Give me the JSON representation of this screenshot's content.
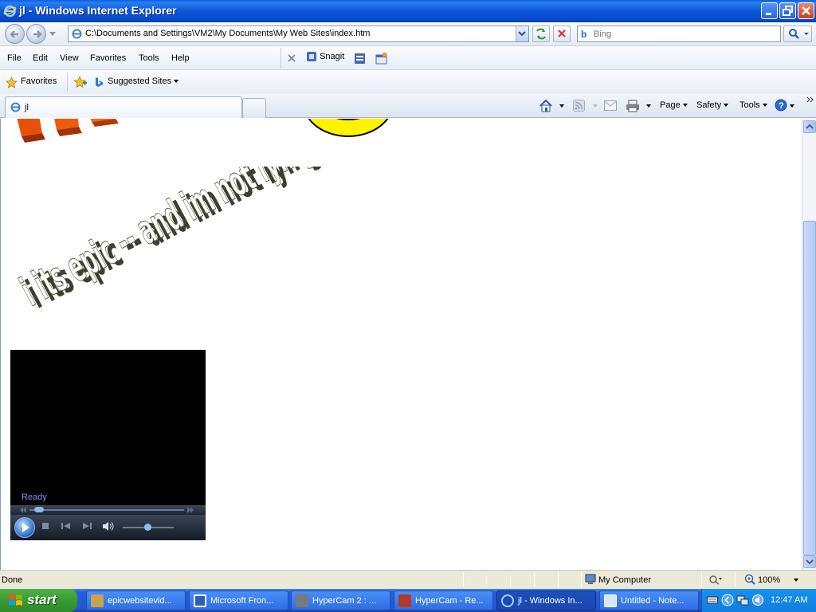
{
  "window": {
    "title": "jl - Windows Internet Explorer"
  },
  "address": {
    "url": "C:\\Documents and Settings\\VM2\\My Documents\\My Web Sites\\index.htm"
  },
  "search": {
    "placeholder": "Bing"
  },
  "menu": {
    "items": [
      "File",
      "Edit",
      "View",
      "Favorites",
      "Tools",
      "Help"
    ],
    "snagit": "Snagit"
  },
  "favorites": {
    "label": "Favorites",
    "suggested": "Suggested Sites"
  },
  "tabs": {
    "current": "jl"
  },
  "commandbar": {
    "page": "Page",
    "safety": "Safety",
    "tools": "Tools"
  },
  "content": {
    "banner_text": "i its epic -- and im not lying",
    "player": {
      "status": "Ready"
    }
  },
  "statusbar": {
    "left": "Done",
    "zone": "My Computer",
    "zoom": "100%"
  },
  "taskbar": {
    "start": "start",
    "items": [
      {
        "label": "epicwebsitevid..."
      },
      {
        "label": "Microsoft Fron..."
      },
      {
        "label": "HyperCam 2 : ..."
      },
      {
        "label": "HyperCam - Re..."
      },
      {
        "label": "jl - Windows In..."
      },
      {
        "label": "Untitled - Note..."
      }
    ],
    "clock": "12:47 AM"
  }
}
